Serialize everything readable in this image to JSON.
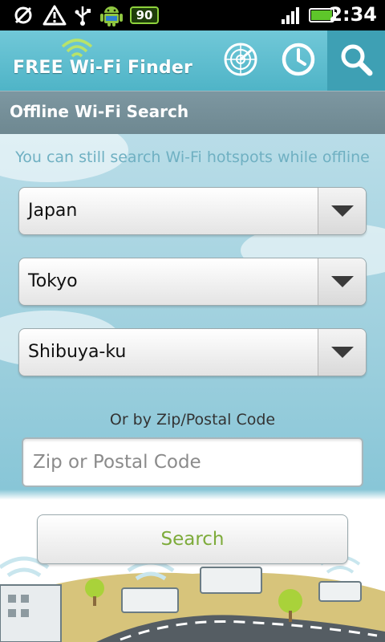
{
  "status_bar": {
    "battery_badge": "90",
    "time": "2:34",
    "icons": [
      "flash-off-icon",
      "warning-icon",
      "usb-icon",
      "android-icon",
      "signal-icon",
      "battery-icon"
    ]
  },
  "header": {
    "app_name": "FREE Wi-Fi Finder",
    "buttons": [
      "radar-icon",
      "clock-icon",
      "search-icon"
    ],
    "active_button": "search-icon"
  },
  "section": {
    "title": "Offline Wi-Fi Search"
  },
  "form": {
    "hint": "You can still search Wi-Fi hotspots while offline",
    "country": "Japan",
    "city": "Tokyo",
    "district": "Shibuya-ku",
    "zip_label": "Or by Zip/Postal Code",
    "zip_placeholder": "Zip or Postal Code",
    "search_label": "Search"
  },
  "colors": {
    "header": "#4fb4c7",
    "section": "#6e8891",
    "search_text": "#7dab3a"
  }
}
